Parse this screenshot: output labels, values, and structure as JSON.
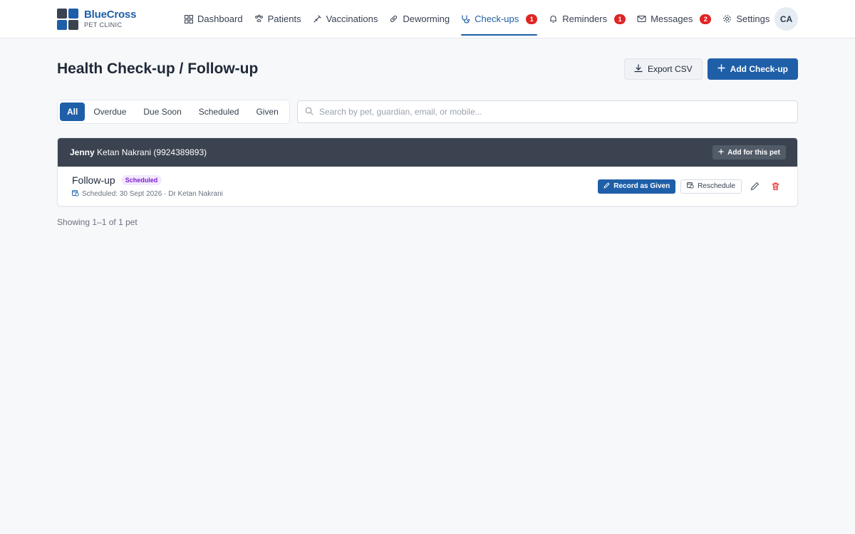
{
  "brand": {
    "name": "BlueCross",
    "sub": "PET CLINIC"
  },
  "nav": [
    {
      "label": "Dashboard",
      "icon": "grid-icon",
      "badge": ""
    },
    {
      "label": "Patients",
      "icon": "paw-icon",
      "badge": ""
    },
    {
      "label": "Vaccinations",
      "icon": "syringe-icon",
      "badge": ""
    },
    {
      "label": "Deworming",
      "icon": "pill-icon",
      "badge": ""
    },
    {
      "label": "Check-ups",
      "icon": "stethoscope-icon",
      "badge": "1",
      "active": true
    },
    {
      "label": "Reminders",
      "icon": "bell-icon",
      "badge": "1"
    },
    {
      "label": "Messages",
      "icon": "mail-icon",
      "badge": "2"
    },
    {
      "label": "Settings",
      "icon": "gear-icon",
      "badge": ""
    }
  ],
  "user": {
    "initials": "CA"
  },
  "page": {
    "title": "Health Check-up / Follow-up",
    "export_label": "Export CSV",
    "add_label": "Add Check-up"
  },
  "filters": {
    "tabs": [
      "All",
      "Overdue",
      "Due Soon",
      "Scheduled",
      "Given"
    ],
    "active": "All"
  },
  "search": {
    "placeholder": "Search by pet, guardian, email, or mobile...",
    "value": ""
  },
  "pets": [
    {
      "pet_name": "Jenny",
      "guardian": "Ketan Nakrani (9924389893)",
      "add_label": "Add for this pet",
      "entries": [
        {
          "title": "Follow-up",
          "status": "Scheduled",
          "detail": "Scheduled: 30 Sept 2026 · Dr Ketan Nakrani",
          "record_label": "Record as Given",
          "reschedule_label": "Reschedule"
        }
      ]
    }
  ],
  "summary": "Showing 1–1 of 1 pet",
  "colors": {
    "primary": "#1f5fa8",
    "dark": "#3b4350",
    "danger": "#e02424",
    "status_scheduled": "#7e22ce"
  }
}
